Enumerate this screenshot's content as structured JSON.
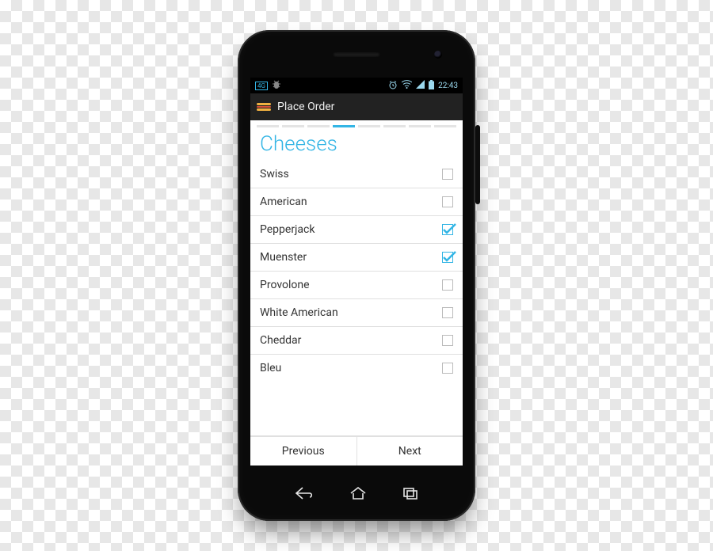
{
  "statusbar": {
    "net_label": "4G",
    "time": "22:43"
  },
  "actionbar": {
    "title": "Place Order"
  },
  "stepper": {
    "total": 8,
    "active_index": 3
  },
  "heading": "Cheeses",
  "items": [
    {
      "label": "Swiss",
      "checked": false
    },
    {
      "label": "American",
      "checked": false
    },
    {
      "label": "Pepperjack",
      "checked": true
    },
    {
      "label": "Muenster",
      "checked": true
    },
    {
      "label": "Provolone",
      "checked": false
    },
    {
      "label": "White American",
      "checked": false
    },
    {
      "label": "Cheddar",
      "checked": false
    },
    {
      "label": "Bleu",
      "checked": false
    }
  ],
  "footer": {
    "previous": "Previous",
    "next": "Next"
  }
}
